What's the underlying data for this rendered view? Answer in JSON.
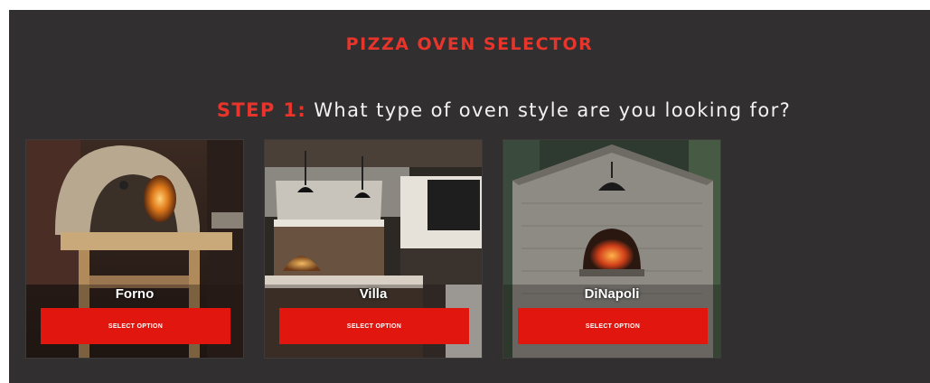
{
  "header": {
    "title": "PIZZA OVEN SELECTOR"
  },
  "step": {
    "label": "STEP 1:",
    "question": "What type of oven style are you looking for?"
  },
  "options": [
    {
      "name": "Forno",
      "button_label": "SELECT OPTION"
    },
    {
      "name": "Villa",
      "button_label": "SELECT OPTION"
    },
    {
      "name": "DiNapoli",
      "button_label": "SELECT OPTION"
    }
  ],
  "colors": {
    "accent": "#e8352b",
    "button": "#e1170f",
    "panel_background": "#322f30"
  }
}
